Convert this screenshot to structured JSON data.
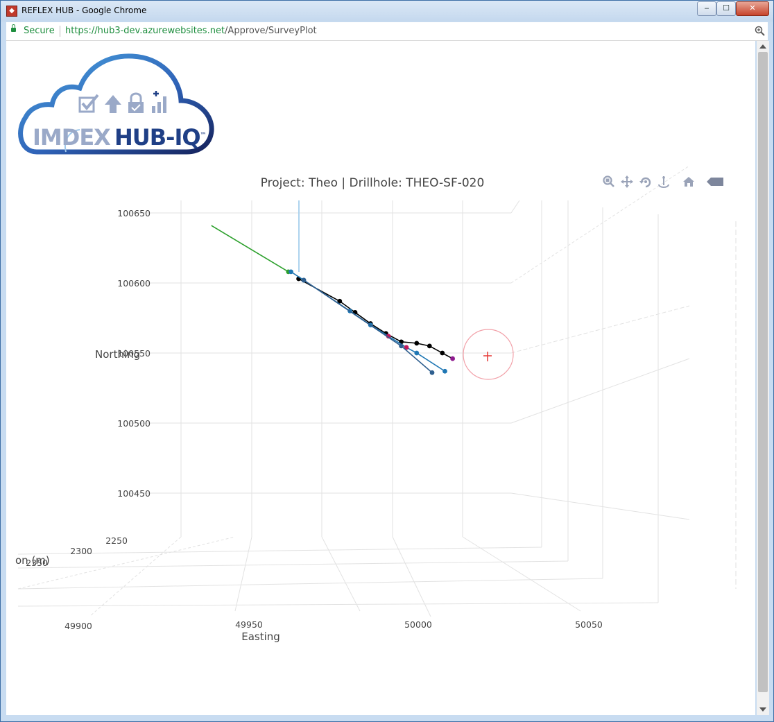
{
  "window": {
    "title": "REFLEX HUB - Google Chrome",
    "min_label": "‒",
    "max_label": "☐",
    "close_label": "✕"
  },
  "addressbar": {
    "secure_label": "Secure",
    "url_host": "https://hub3-dev.azurewebsites.net",
    "url_path": "/Approve/SurveyPlot"
  },
  "logo": {
    "text_part1": "IMDEX",
    "text_part2": "HUB-IQ",
    "trademark": "™",
    "icons": [
      "checkbox-icon",
      "upload-arrow-icon",
      "lock-check-icon",
      "bar-chart-plus-icon"
    ]
  },
  "modebar": {
    "buttons": [
      "zoom-icon",
      "pan-icon",
      "orbit-rotation-icon",
      "turntable-rotation-icon",
      "reset-camera-home-icon",
      "plotly-logo-icon"
    ]
  },
  "chart_data": {
    "type": "scatter3d-projection",
    "title": "Project: Theo | Drillhole: THEO-SF-020",
    "northing_axis": {
      "label": "Northing",
      "ticks": [
        "100650",
        "100600",
        "100550",
        "100500",
        "100450"
      ]
    },
    "easting_axis": {
      "label": "Easting",
      "ticks": [
        "49900",
        "49950",
        "50000",
        "50050"
      ]
    },
    "elevation_axis": {
      "label": "on (m)",
      "ticks": [
        "2250",
        "2300",
        "2350"
      ]
    },
    "grid": true,
    "legend": "none",
    "colors": {
      "planned": "#2ca02c",
      "collar_line": "#aed3ee",
      "survey_a": "#1f77b4",
      "survey_b": "#2f5f8f",
      "black_trace": "#000000",
      "highlight": "#c2185b",
      "target_circle": "#f2a0a8",
      "target_marker": "#e53935"
    },
    "series": [
      {
        "name": "",
        "color": "#2ca02c",
        "kind": "line",
        "points": [
          [
            49934,
            100641
          ],
          [
            49964,
            100608
          ]
        ]
      },
      {
        "name": "",
        "color": "#000000",
        "kind": "line+markers",
        "points": [
          [
            49968,
            100603
          ],
          [
            49984,
            100587
          ],
          [
            49990,
            100579
          ],
          [
            49996,
            100571
          ],
          [
            50002,
            100564
          ],
          [
            50008,
            100558
          ],
          [
            50014,
            100557
          ],
          [
            50019,
            100555
          ],
          [
            50024,
            100550
          ],
          [
            50028,
            100546
          ]
        ]
      },
      {
        "name": "",
        "color": "#1f77b4",
        "kind": "line+markers",
        "points": [
          [
            49965,
            100608
          ],
          [
            49970,
            100602
          ],
          [
            49988,
            100580
          ],
          [
            49996,
            100570
          ],
          [
            50003,
            100562
          ],
          [
            50010,
            100554
          ],
          [
            50014,
            100550
          ],
          [
            50025,
            100537
          ]
        ]
      },
      {
        "name": "",
        "color": "#2f5f8f",
        "kind": "line+markers",
        "points": [
          [
            49970,
            100602
          ],
          [
            50008,
            100555
          ],
          [
            50020,
            100536
          ]
        ]
      }
    ]
  }
}
